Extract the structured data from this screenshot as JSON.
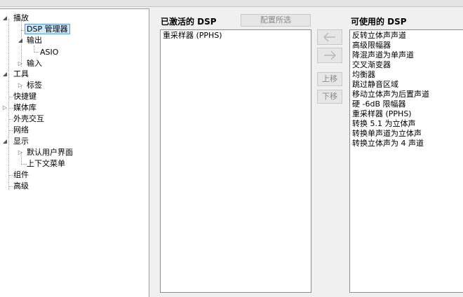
{
  "tree": [
    {
      "label": "播放"
    },
    {
      "label": "DSP 管理器"
    },
    {
      "label": "输出"
    },
    {
      "label": "ASIO"
    },
    {
      "label": "输入"
    },
    {
      "label": "工具"
    },
    {
      "label": "标签"
    },
    {
      "label": "快捷键"
    },
    {
      "label": "媒体库"
    },
    {
      "label": "外壳交互"
    },
    {
      "label": "网络"
    },
    {
      "label": "显示"
    },
    {
      "label": "默认用户界面"
    },
    {
      "label": "上下文菜单"
    },
    {
      "label": "组件"
    },
    {
      "label": "高级"
    }
  ],
  "active": {
    "header": "已激活的 DSP",
    "config_button": "配置所选",
    "items": [
      "重采样器 (PPHS)"
    ]
  },
  "controls": {
    "add_icon": "arrow-left-icon",
    "remove_icon": "arrow-right-icon",
    "move_up": "上移",
    "move_down": "下移"
  },
  "available": {
    "header": "可使用的 DSP",
    "items": [
      "反转立体声声道",
      "高级限幅器",
      "降混声道为单声道",
      "交叉渐变器",
      "均衡器",
      "跳过静音区域",
      "移动立体声为后置声道",
      "硬 -6dB 限幅器",
      "重采样器 (PPHS)",
      "转换 5.1 为立体声",
      "转换单声道为立体声",
      "转换立体声为 4 声道"
    ]
  }
}
